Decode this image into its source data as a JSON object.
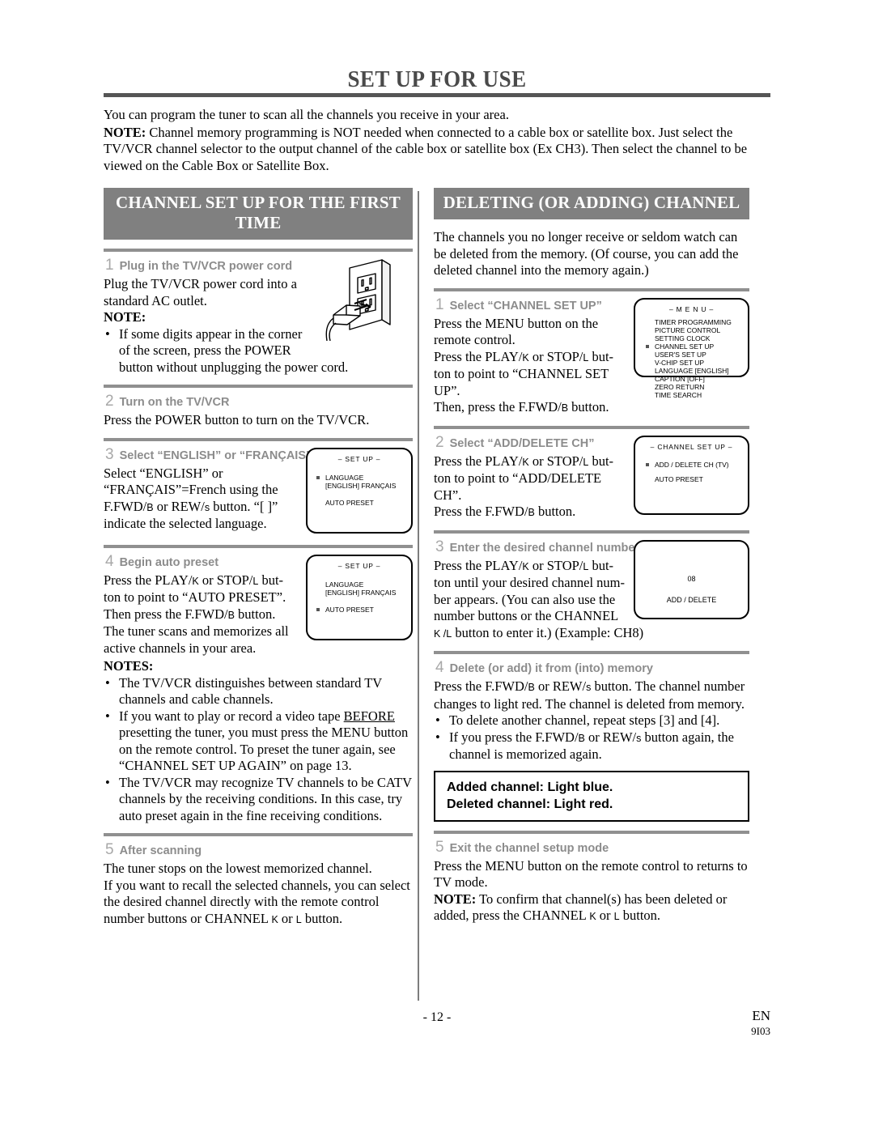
{
  "header": {
    "title": "SET UP FOR USE"
  },
  "intro": {
    "line1": "You can program the tuner to scan all the channels you receive in your area.",
    "note_label": "NOTE:",
    "note_text": " Channel memory programming is NOT needed when connected to a cable box or satellite box. Just select the TV/VCR channel selector to the output channel of the cable box or satellite box (Ex CH3). Then select the channel to be viewed on the Cable Box or Satellite Box."
  },
  "left_column": {
    "banner": "CHANNEL SET UP FOR THE FIRST TIME",
    "steps": {
      "s1": {
        "num": "1",
        "title": "Plug in the TV/VCR power cord",
        "body": "Plug the TV/VCR power cord into a standard AC outlet.",
        "note_label": "NOTE:",
        "bullet1": "If some digits appear in the corner of the screen, press the POWER button without unplugging the power cord."
      },
      "s2": {
        "num": "2",
        "title": "Turn on the TV/VCR",
        "body": "Press the POWER button to turn on the TV/VCR."
      },
      "s3": {
        "num": "3",
        "title": "Select “ENGLISH” or “FRANÇAIS”",
        "body_a": "Select “ENGLISH” or “FRANÇAIS”=French using the F.FWD/",
        "body_b": "B",
        "body_c": " or REW/",
        "body_d": "s",
        "body_e": " button. “[ ]” indicate the selected language.",
        "osd": {
          "title": "– SET UP –",
          "item1_l1": "LANGUAGE",
          "item1_l2": "[ENGLISH]   FRANÇAIS",
          "item2": "AUTO PRESET"
        }
      },
      "s4": {
        "num": "4",
        "title": "Begin auto preset",
        "body_a": "Press the PLAY/",
        "body_b": "K",
        "body_c": " or STOP/",
        "body_d": "L",
        "body_e": " but-ton to point to “AUTO PRESET”.",
        "body_f": "Then press the F.FWD/",
        "body_g": "B",
        "body_h": " button.",
        "body_i": "The tuner scans and memorizes all active channels in your area.",
        "osd": {
          "title": "– SET UP –",
          "item1_l1": "LANGUAGE",
          "item1_l2": "[ENGLISH]   FRANÇAIS",
          "item2": "AUTO PRESET"
        }
      },
      "notes_label": "NOTES:",
      "notes": {
        "n1": "The TV/VCR distinguishes between standard TV channels and cable channels.",
        "n2_a": "If you want to play or record a video tape ",
        "n2_underline": "BEFORE",
        "n2_b": " presetting the tuner, you must press the MENU button on the remote control. To preset the tuner again, see “CHANNEL SET UP AGAIN” on page 13.",
        "n3": "The TV/VCR may recognize TV channels to be CATV channels by the receiving conditions. In this case, try auto preset again in the fine receiving conditions."
      },
      "s5": {
        "num": "5",
        "title": "After scanning",
        "body_a": "The tuner stops on the lowest memorized channel.",
        "body_b": "If you want to recall the selected channels, you can select the desired channel directly with the remote control number buttons or CHANNEL ",
        "body_c": "K",
        "body_d": " or ",
        "body_e": "L",
        "body_f": " button."
      }
    }
  },
  "right_column": {
    "banner": "DELETING (OR ADDING) CHANNEL",
    "intro": "The channels you no longer receive or seldom watch can be deleted from the memory. (Of course, you can add the deleted channel into the memory again.)",
    "steps": {
      "s1": {
        "num": "1",
        "title": "Select “CHANNEL SET UP”",
        "body_a": "Press the MENU button on the remote control.",
        "body_b": "Press the PLAY/",
        "body_c": "K",
        "body_d": " or STOP/",
        "body_e": "L",
        "body_f": " but-ton to point to “CHANNEL SET UP”.",
        "body_g": "Then, press the F.FWD/",
        "body_h": "B",
        "body_i": " button.",
        "osd": {
          "title": "– M E N U –",
          "items": [
            "TIMER PROGRAMMING",
            "PICTURE CONTROL",
            "SETTING CLOCK",
            "CHANNEL SET UP",
            "USER'S SET UP",
            "V-CHIP SET UP",
            "LANGUAGE  [ENGLISH]",
            "CAPTION  [OFF]",
            "ZERO RETURN",
            "TIME SEARCH"
          ],
          "cursor_index": 3
        }
      },
      "s2": {
        "num": "2",
        "title": "Select “ADD/DELETE CH”",
        "body_a": "Press the PLAY/",
        "body_b": "K",
        "body_c": " or STOP/",
        "body_d": "L",
        "body_e": " but-ton to point to “ADD/DELETE CH”.",
        "body_f": "Press the F.FWD/",
        "body_g": "B",
        "body_h": " button.",
        "osd": {
          "title": "– CHANNEL SET UP –",
          "item1": "ADD / DELETE CH (TV)",
          "item2": "AUTO PRESET"
        }
      },
      "s3": {
        "num": "3",
        "title": "Enter the desired channel number",
        "body_a": "Press the PLAY/",
        "body_b": "K",
        "body_c": " or STOP/",
        "body_d": "L",
        "body_e": " but-ton until your desired channel num-ber appears. (You can also use the number buttons  or the CHANNEL ",
        "body_f": "K /L",
        "body_g": " button to enter it.) (Example: CH8)",
        "osd": {
          "channel": "08",
          "label": "ADD / DELETE"
        }
      },
      "s4": {
        "num": "4",
        "title": "Delete (or add) it from (into) memory",
        "body_a": "Press the F.FWD/",
        "body_b": "B",
        "body_c": " or REW/",
        "body_d": "s",
        "body_e": " button. The channel number changes to light red. The channel is deleted from memory.",
        "bullet1": "To delete another channel, repeat steps [3] and [4].",
        "bullet2_a": "If you press the F.FWD/",
        "bullet2_b": "B",
        "bullet2_c": " or REW/",
        "bullet2_d": "s",
        "bullet2_e": " button again, the channel is memorized again."
      },
      "callout": {
        "line1": "Added channel: Light blue.",
        "line2": "Deleted channel: Light red."
      },
      "s5": {
        "num": "5",
        "title": "Exit the channel setup mode",
        "body_a": "Press the MENU button on the remote control to returns to TV mode.",
        "note_label": "NOTE:",
        "note_a": " To confirm that channel(s) has been deleted or added, press the CHANNEL ",
        "note_b": "K",
        "note_c": " or ",
        "note_d": "L",
        "note_e": " button."
      }
    }
  },
  "footer": {
    "page": "- 12 -",
    "lang": "EN",
    "code": "9I03"
  }
}
